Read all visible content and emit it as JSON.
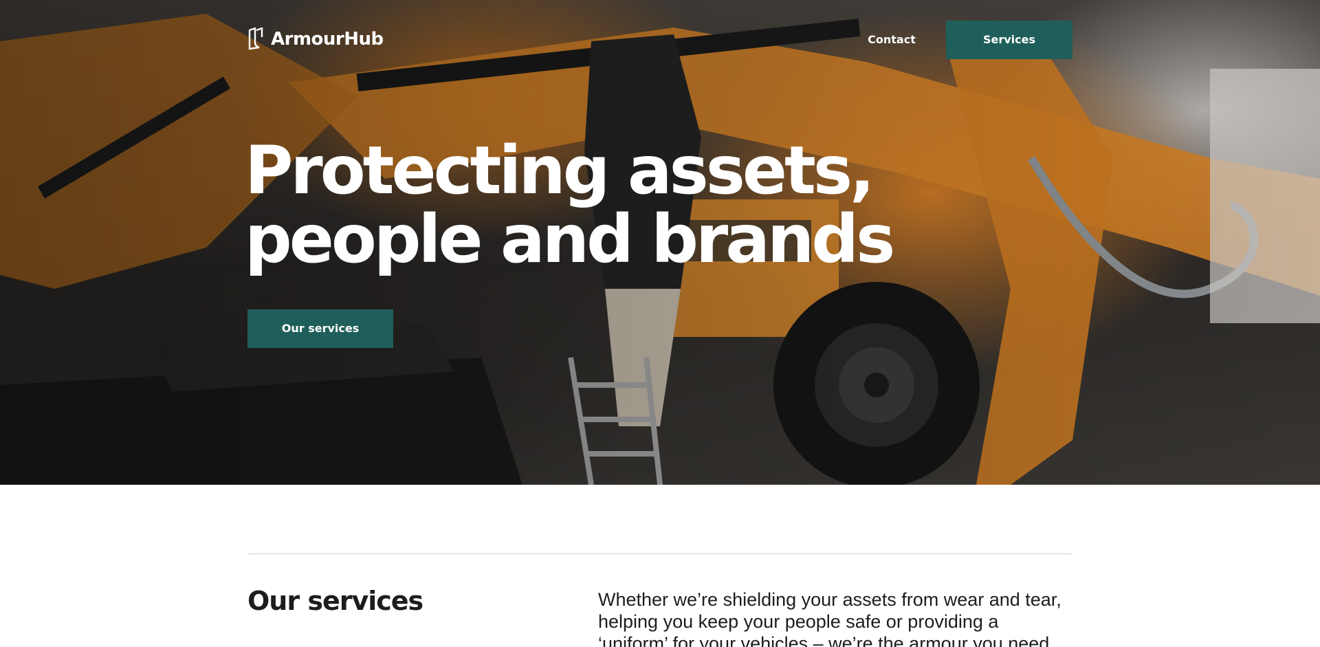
{
  "brand": {
    "name": "ArmourHub",
    "logo_icon": "shield-icon"
  },
  "nav": {
    "contact_label": "Contact",
    "services_label": "Services"
  },
  "hero": {
    "headline_line1": "Protecting assets,",
    "headline_line2": "people and brands",
    "cta_label": "Our services"
  },
  "services": {
    "title": "Our services",
    "description": "Whether we’re shielding your assets from wear and tear, helping you keep your people safe or providing a ‘uniform’ for your vehicles – we’re the armour you need."
  },
  "colors": {
    "accent": "#1f5f5b",
    "hero_orange": "#dd8226",
    "text": "#1d1d1d",
    "divider": "#cfcfcf"
  }
}
